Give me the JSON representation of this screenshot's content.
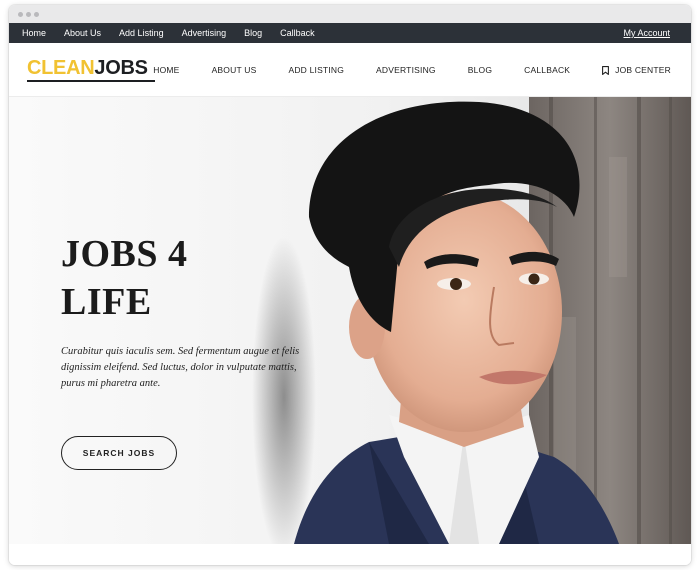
{
  "topbar": {
    "links": [
      "Home",
      "About Us",
      "Add Listing",
      "Advertising",
      "Blog",
      "Callback"
    ],
    "account": "My Account"
  },
  "logo": {
    "part1": "CLEAN",
    "part2": "JOBS"
  },
  "nav": {
    "items": [
      "HOME",
      "ABOUT US",
      "ADD LISTING",
      "ADVERTISING",
      "BLOG",
      "CALLBACK"
    ],
    "job_center": "JOB CENTER"
  },
  "hero": {
    "title_line1": "JOBS 4",
    "title_line2": "LIFE",
    "text": "Curabitur quis iaculis sem. Sed fermentum augue et felis dignissim eleifend. Sed luctus, dolor in vulputate mattis, purus mi pharetra ante.",
    "button": "SEARCH JOBS"
  },
  "icons": {
    "job_center": "bookmark-icon"
  },
  "colors": {
    "brand_yellow": "#f1c232",
    "topbar": "#2c3138",
    "text_dark": "#1d1f22"
  }
}
